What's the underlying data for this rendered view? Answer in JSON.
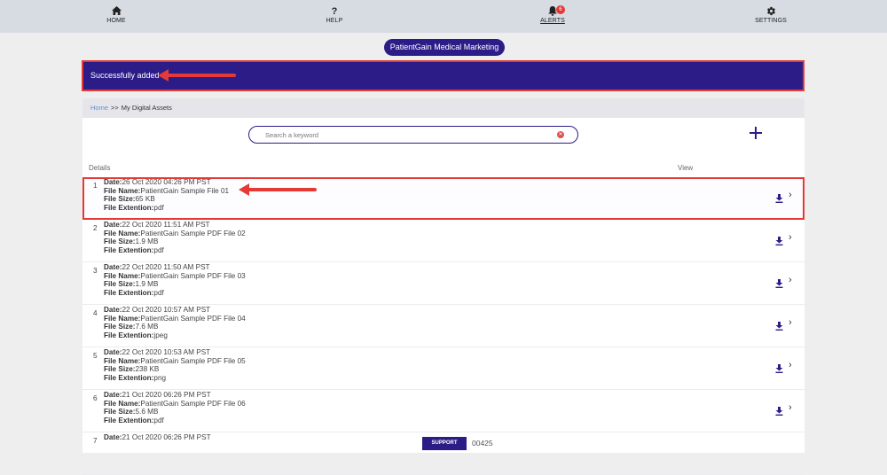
{
  "nav": {
    "home": "HOME",
    "help": "HELP",
    "alerts": "ALERTS",
    "alerts_count": "6",
    "settings": "SETTINGS"
  },
  "brand": "PatientGain Medical Marketing",
  "notice": "Successfully added",
  "breadcrumb": {
    "home": "Home",
    "separator": ">>",
    "current": "My Digital Assets"
  },
  "search": {
    "placeholder": "Search a keyword"
  },
  "columns": {
    "details": "Details",
    "view": "View"
  },
  "field_labels": {
    "date": "Date:",
    "name": "File Name:",
    "size": "File Size:",
    "ext": "File Extention:"
  },
  "assets": [
    {
      "index": "1",
      "date": "26 Oct 2020 04:26 PM PST",
      "name": "PatientGain Sample File 01",
      "size": "65 KB",
      "ext": "pdf"
    },
    {
      "index": "2",
      "date": "22 Oct 2020 11:51 AM PST",
      "name": "PatientGain Sample PDF File 02",
      "size": "1.9 MB",
      "ext": "pdf"
    },
    {
      "index": "3",
      "date": "22 Oct 2020 11:50 AM PST",
      "name": "PatientGain Sample PDF File 03",
      "size": "1.9 MB",
      "ext": "pdf"
    },
    {
      "index": "4",
      "date": "22 Oct 2020 10:57 AM PST",
      "name": "PatientGain Sample PDF File 04",
      "size": "7.6 MB",
      "ext": "jpeg"
    },
    {
      "index": "5",
      "date": "22 Oct 2020 10:53 AM PST",
      "name": "PatientGain Sample PDF File 05",
      "size": "238 KB",
      "ext": "png"
    },
    {
      "index": "6",
      "date": "21 Oct 2020 06:26 PM PST",
      "name": "PatientGain Sample PDF File 06",
      "size": "5.6 MB",
      "ext": "pdf"
    },
    {
      "index": "7",
      "date": "21 Oct 2020 06:26 PM PST",
      "name": "",
      "size": "",
      "ext": ""
    }
  ],
  "footer": {
    "support": "SUPPORT",
    "code": "00425"
  },
  "colors": {
    "brand": "#2c1c87",
    "annotation": "#e53935",
    "link": "#5b8fd6"
  }
}
